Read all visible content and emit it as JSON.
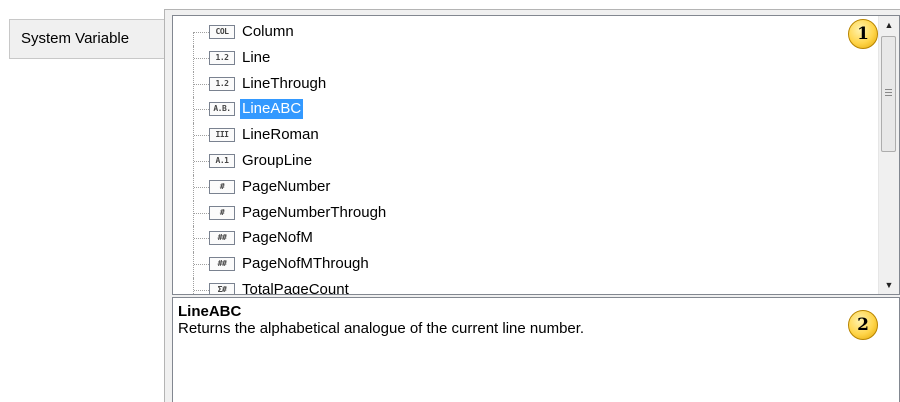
{
  "tab": {
    "label": "System Variable"
  },
  "tree": {
    "selected_index": 3,
    "items": [
      {
        "icon": "COL",
        "label": "Column"
      },
      {
        "icon": "1.2",
        "label": "Line"
      },
      {
        "icon": "1.2",
        "label": "LineThrough"
      },
      {
        "icon": "A.B.",
        "label": "LineABC"
      },
      {
        "icon": "III",
        "label": "LineRoman"
      },
      {
        "icon": "A.1",
        "label": "GroupLine"
      },
      {
        "icon": "#",
        "label": "PageNumber"
      },
      {
        "icon": "#",
        "label": "PageNumberThrough"
      },
      {
        "icon": "##",
        "label": "PageNofM"
      },
      {
        "icon": "##",
        "label": "PageNofMThrough"
      },
      {
        "icon": "Σ#",
        "label": "TotalPageCount"
      }
    ]
  },
  "description": {
    "title": "LineABC",
    "text": "Returns the alphabetical analogue of the current line number."
  },
  "callouts": {
    "one": "1",
    "two": "2"
  },
  "colors": {
    "selection": "#3399ff",
    "callout": "#ffd54a"
  }
}
